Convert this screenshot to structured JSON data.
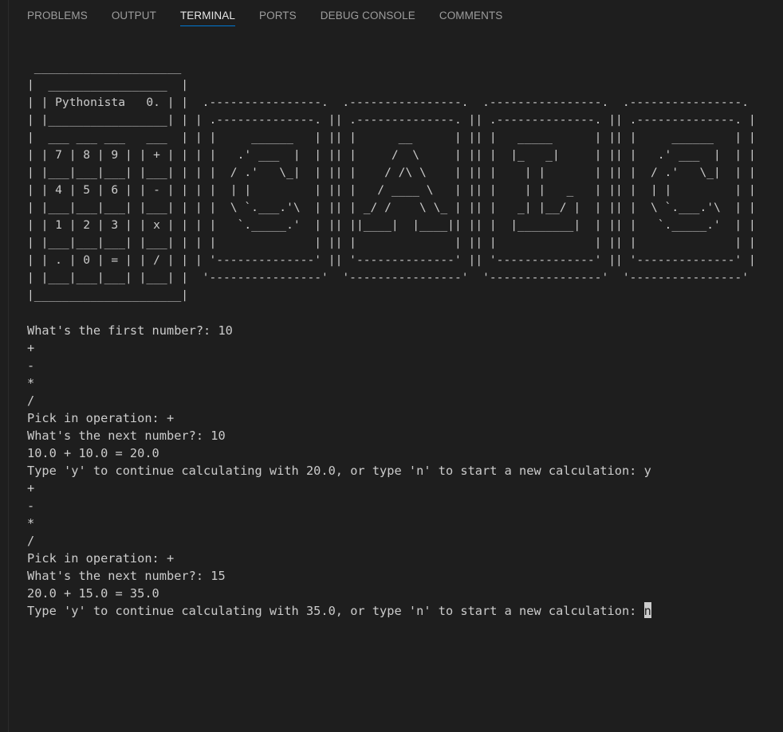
{
  "panel": {
    "tabs": [
      {
        "label": "PROBLEMS",
        "active": false
      },
      {
        "label": "OUTPUT",
        "active": false
      },
      {
        "label": "TERMINAL",
        "active": true
      },
      {
        "label": "PORTS",
        "active": false
      },
      {
        "label": "DEBUG CONSOLE",
        "active": false
      },
      {
        "label": "COMMENTS",
        "active": false
      }
    ]
  },
  "terminal": {
    "ascii_art": " _____________________\n|  _________________  |\n| | Pythonista   0. | |  .----------------.  .----------------.  .----------------.  .----------------.\n| |_________________| | | .--------------. || .--------------. || .--------------. || .--------------. |\n|  ___ ___ ___   ___  | | |     ______   | || |      __      | || |   _____      | || |     ______   | |\n| | 7 | 8 | 9 | | + | | | |   .' ___  |  | || |     /  \\     | || |  |_   _|     | || |   .' ___  |  | |\n| |___|___|___| |___| | | |  / .'   \\_|  | || |    / /\\ \\    | || |    | |       | || |  / .'   \\_|  | |\n| | 4 | 5 | 6 | | - | | | |  | |         | || |   / ____ \\   | || |    | |   _   | || |  | |         | |\n| |___|___|___| |___| | | |  \\ `.___.'\\  | || | _/ /    \\ \\_ | || |   _| |__/ |  | || |  \\ `.___.'\\  | |\n| | 1 | 2 | 3 | | x | | | |   `._____.'  | || ||____|  |____|| || |  |________|  | || |   `._____.'  | |\n| |___|___|___| |___| | | |              | || |              | || |              | || |              | |\n| | . | 0 | = | | / | | | '--------------' || '--------------' || '--------------' || '--------------' |\n| |___|___|___| |___| |  '----------------'  '----------------'  '----------------'  '----------------'\n|_____________________|",
    "lines": [
      "What's the first number?: 10",
      "+",
      "-",
      "*",
      "/",
      "Pick in operation: +",
      "What's the next number?: 10",
      "10.0 + 10.0 = 20.0",
      "Type 'y' to continue calculating with 20.0, or type 'n' to start a new calculation: y",
      "+",
      "-",
      "*",
      "/",
      "Pick in operation: +",
      "What's the next number?: 15",
      "20.0 + 15.0 = 35.0"
    ],
    "prompt": "Type 'y' to continue calculating with 35.0, or type 'n' to start a new calculation: ",
    "input_value": "n"
  }
}
